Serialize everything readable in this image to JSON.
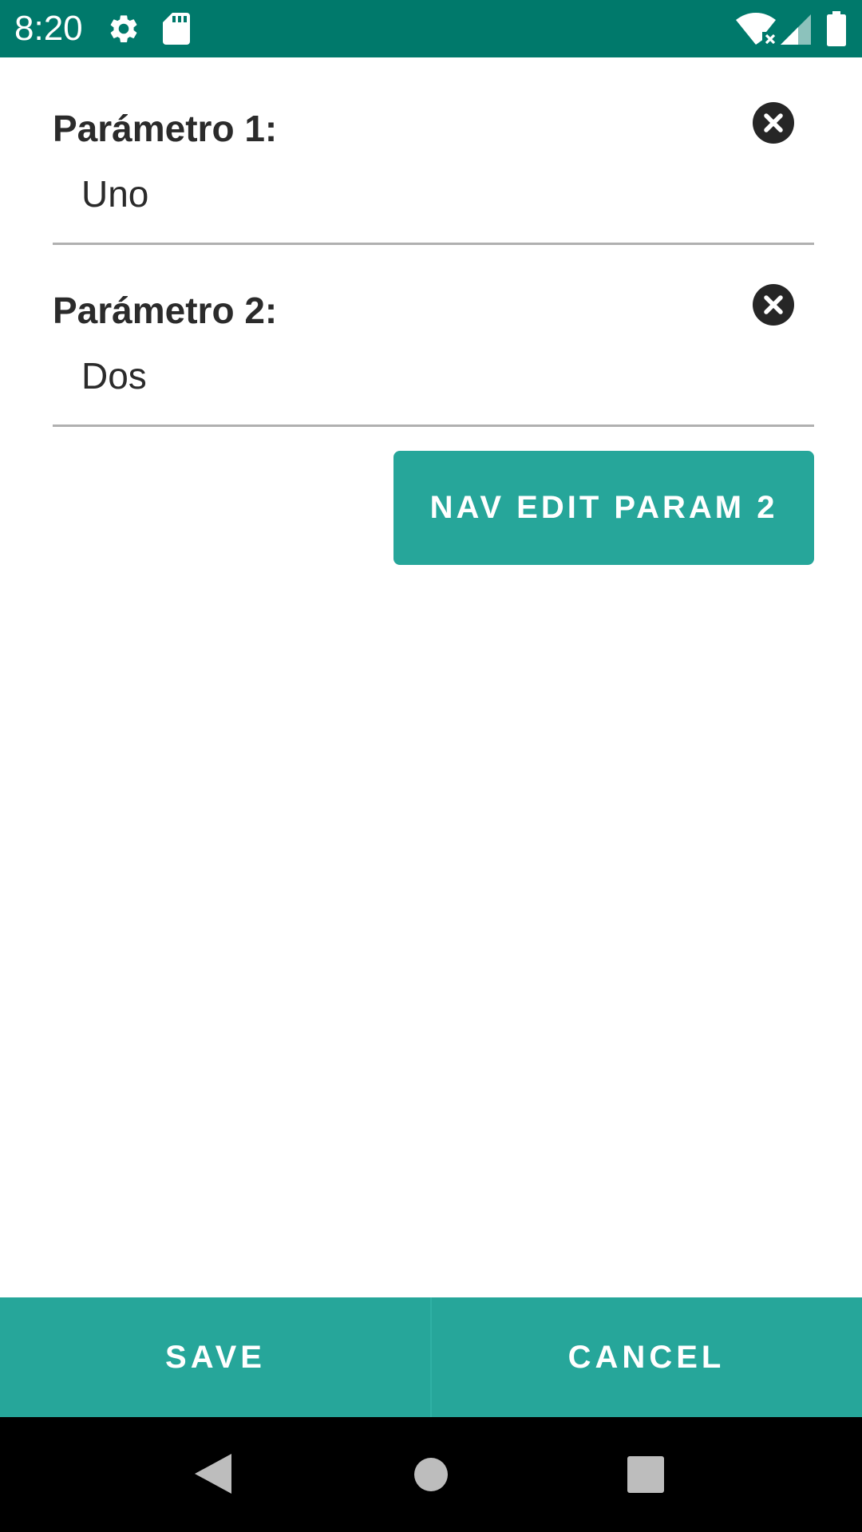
{
  "status_bar": {
    "time": "8:20",
    "background_color": "#00796B",
    "icons": [
      "settings-icon",
      "sd-card-icon",
      "wifi-icon",
      "signal-icon",
      "battery-icon"
    ]
  },
  "params": [
    {
      "label": "Parámetro 1:",
      "value": "Uno",
      "clear_icon": "clear-icon"
    },
    {
      "label": "Parámetro 2:",
      "value": "Dos",
      "clear_icon": "clear-icon"
    }
  ],
  "nav_button": {
    "label": "NAV EDIT PARAM 2",
    "color": "#26A69A"
  },
  "actions": {
    "save_label": "SAVE",
    "cancel_label": "CANCEL",
    "color": "#26A69A"
  },
  "system_nav": {
    "icons": [
      "back-icon",
      "home-icon",
      "recents-icon"
    ]
  }
}
